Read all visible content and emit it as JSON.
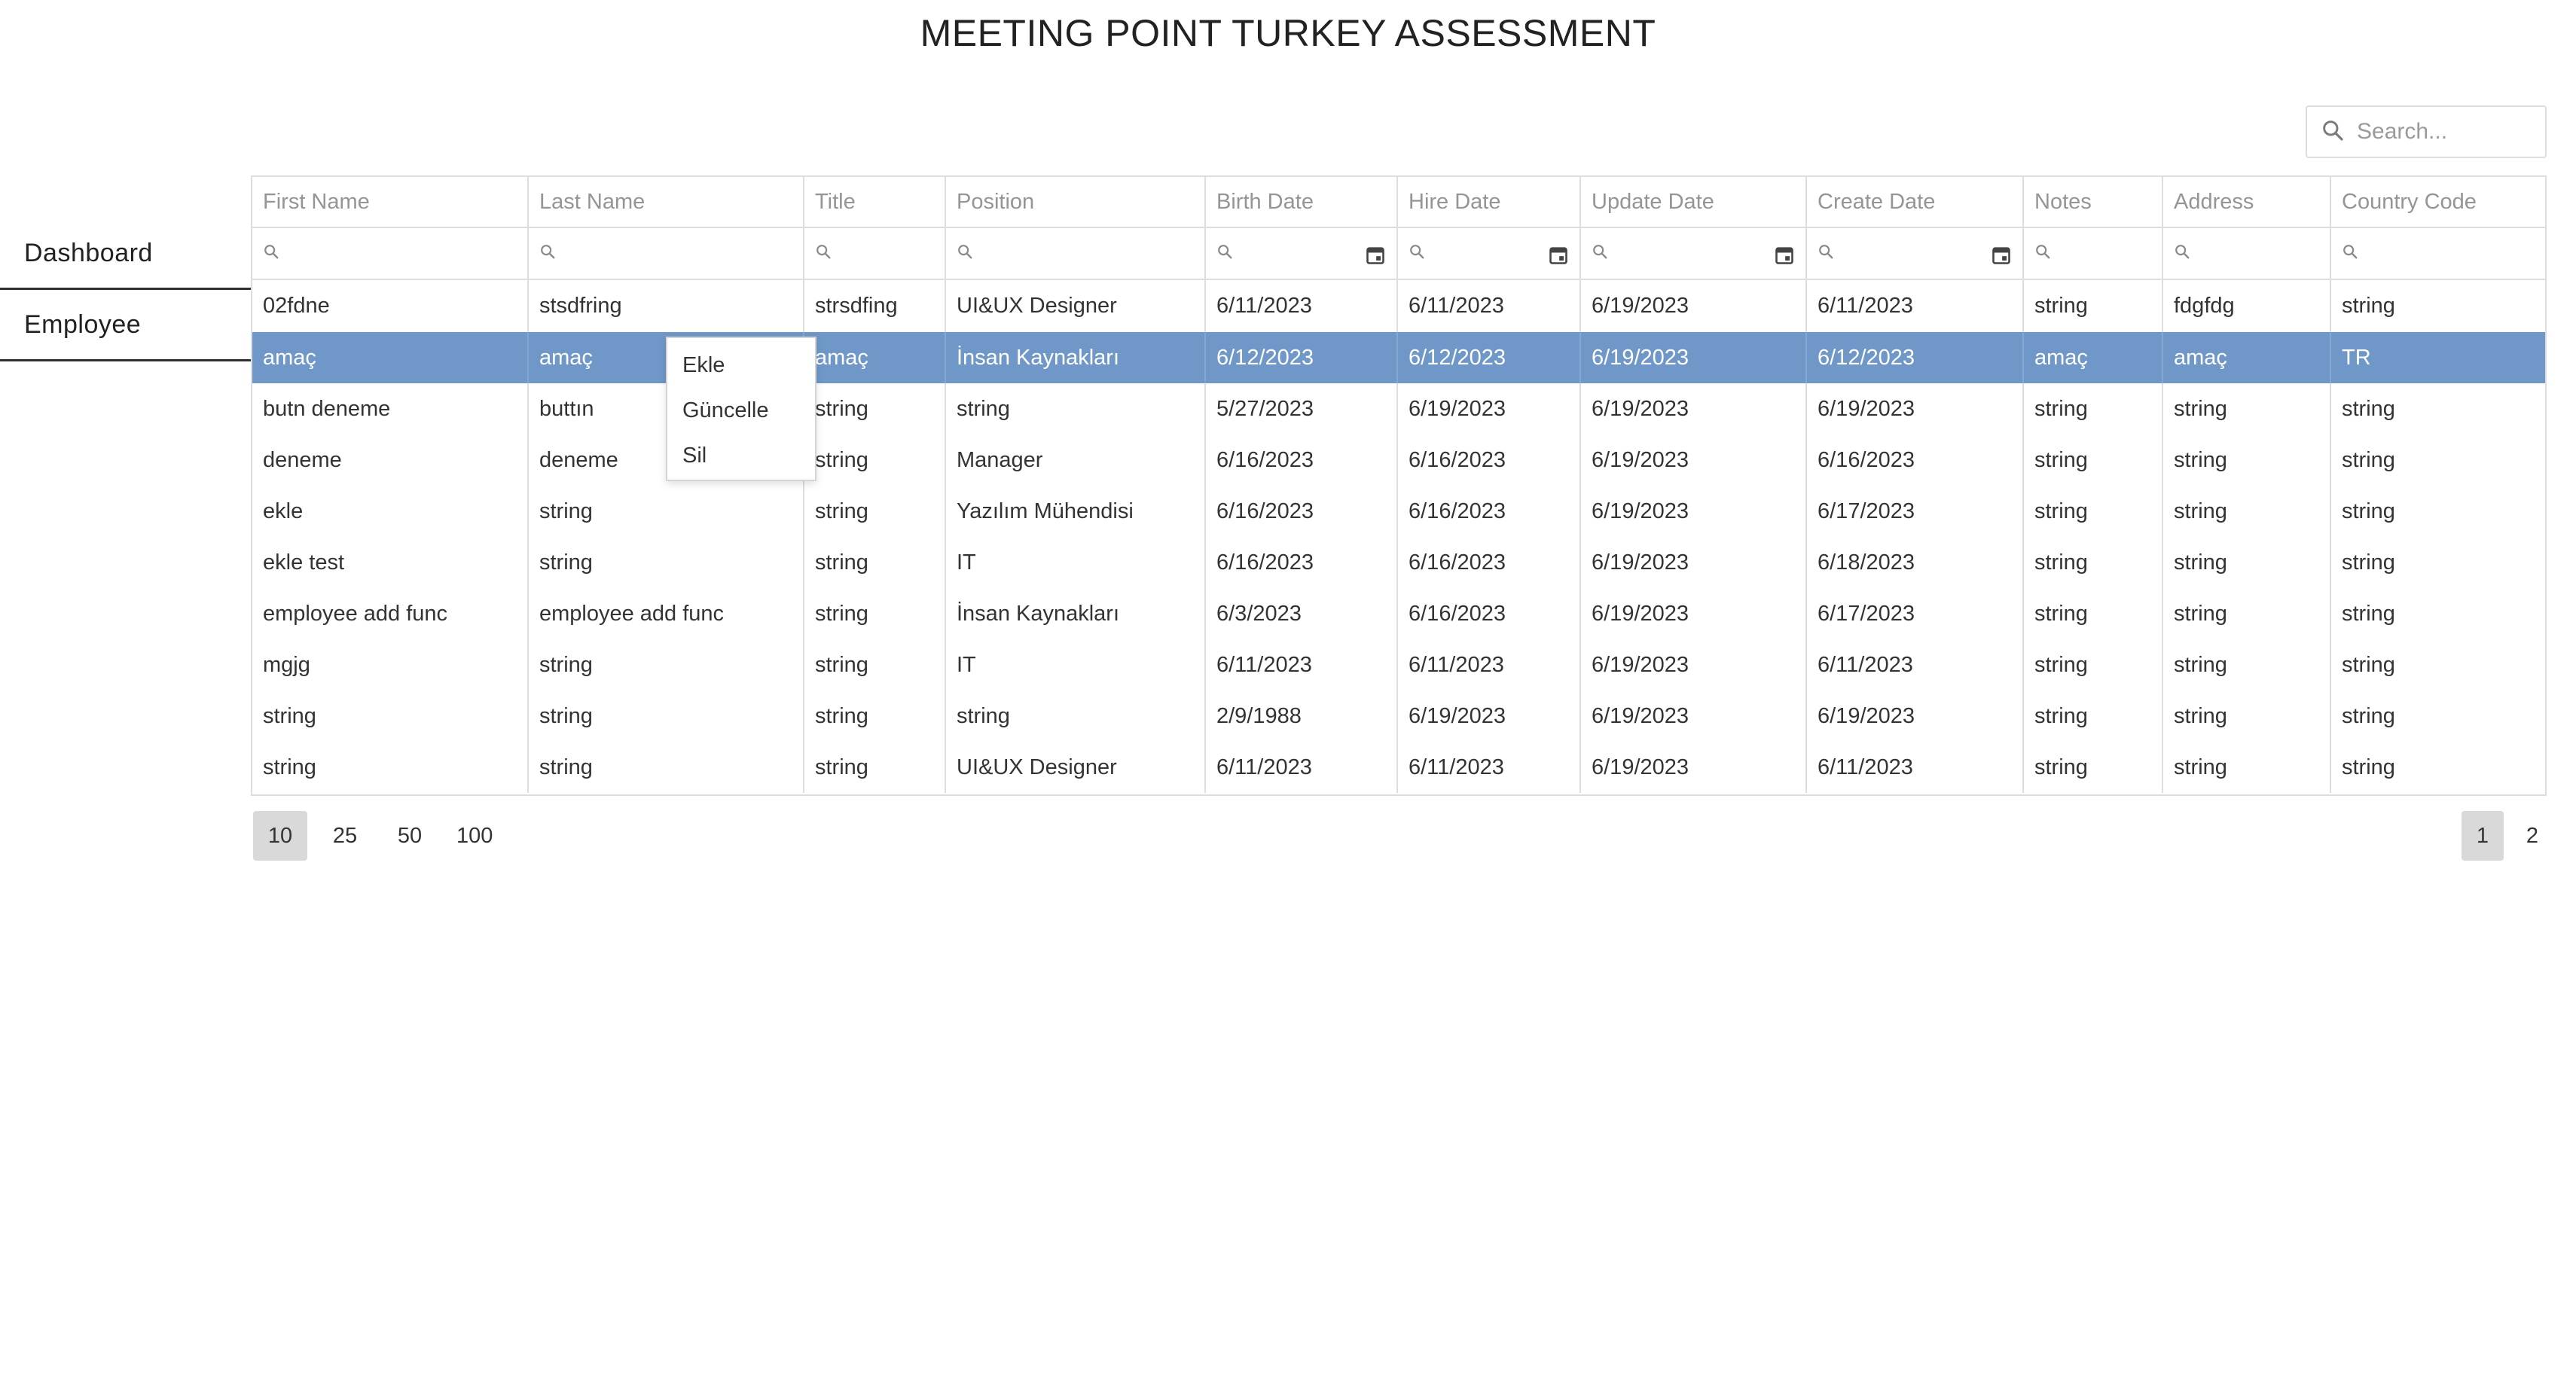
{
  "page": {
    "title": "MEETING POINT TURKEY ASSESSMENT"
  },
  "sidebar": {
    "items": [
      {
        "label": "Dashboard"
      },
      {
        "label": "Employee"
      }
    ]
  },
  "search": {
    "placeholder": "Search...",
    "value": ""
  },
  "grid": {
    "columns": [
      "First Name",
      "Last Name",
      "Title",
      "Position",
      "Birth Date",
      "Hire Date",
      "Update Date",
      "Create Date",
      "Notes",
      "Address",
      "Country Code"
    ],
    "date_columns": [
      4,
      5,
      6,
      7
    ],
    "selected_row": 1,
    "selection_color": "#6f98c8",
    "rows": [
      [
        "02fdne",
        "stsdfring",
        "strsdfing",
        "UI&UX Designer",
        "6/11/2023",
        "6/11/2023",
        "6/19/2023",
        "6/11/2023",
        "string",
        "fdgfdg",
        "string"
      ],
      [
        "amaç",
        "amaç",
        "amaç",
        "İnsan Kaynakları",
        "6/12/2023",
        "6/12/2023",
        "6/19/2023",
        "6/12/2023",
        "amaç",
        "amaç",
        "TR"
      ],
      [
        "butn deneme",
        "buttın",
        "string",
        "string",
        "5/27/2023",
        "6/19/2023",
        "6/19/2023",
        "6/19/2023",
        "string",
        "string",
        "string"
      ],
      [
        "deneme",
        "deneme",
        "string",
        "Manager",
        "6/16/2023",
        "6/16/2023",
        "6/19/2023",
        "6/16/2023",
        "string",
        "string",
        "string"
      ],
      [
        "ekle",
        "string",
        "string",
        "Yazılım Mühendisi",
        "6/16/2023",
        "6/16/2023",
        "6/19/2023",
        "6/17/2023",
        "string",
        "string",
        "string"
      ],
      [
        "ekle test",
        "string",
        "string",
        "IT",
        "6/16/2023",
        "6/16/2023",
        "6/19/2023",
        "6/18/2023",
        "string",
        "string",
        "string"
      ],
      [
        "employee add func",
        "employee add func",
        "string",
        "İnsan Kaynakları",
        "6/3/2023",
        "6/16/2023",
        "6/19/2023",
        "6/17/2023",
        "string",
        "string",
        "string"
      ],
      [
        "mgjg",
        "string",
        "string",
        "IT",
        "6/11/2023",
        "6/11/2023",
        "6/19/2023",
        "6/11/2023",
        "string",
        "string",
        "string"
      ],
      [
        "string",
        "string",
        "string",
        "string",
        "2/9/1988",
        "6/19/2023",
        "6/19/2023",
        "6/19/2023",
        "string",
        "string",
        "string"
      ],
      [
        "string",
        "string",
        "string",
        "UI&UX Designer",
        "6/11/2023",
        "6/11/2023",
        "6/19/2023",
        "6/11/2023",
        "string",
        "string",
        "string"
      ]
    ]
  },
  "context_menu": {
    "items": [
      {
        "label": "Ekle"
      },
      {
        "label": "Güncelle"
      },
      {
        "label": "Sil"
      }
    ]
  },
  "pager": {
    "page_sizes": [
      "10",
      "25",
      "50",
      "100"
    ],
    "selected_size": "10",
    "pages": [
      "1",
      "2"
    ],
    "current_page": "1"
  }
}
